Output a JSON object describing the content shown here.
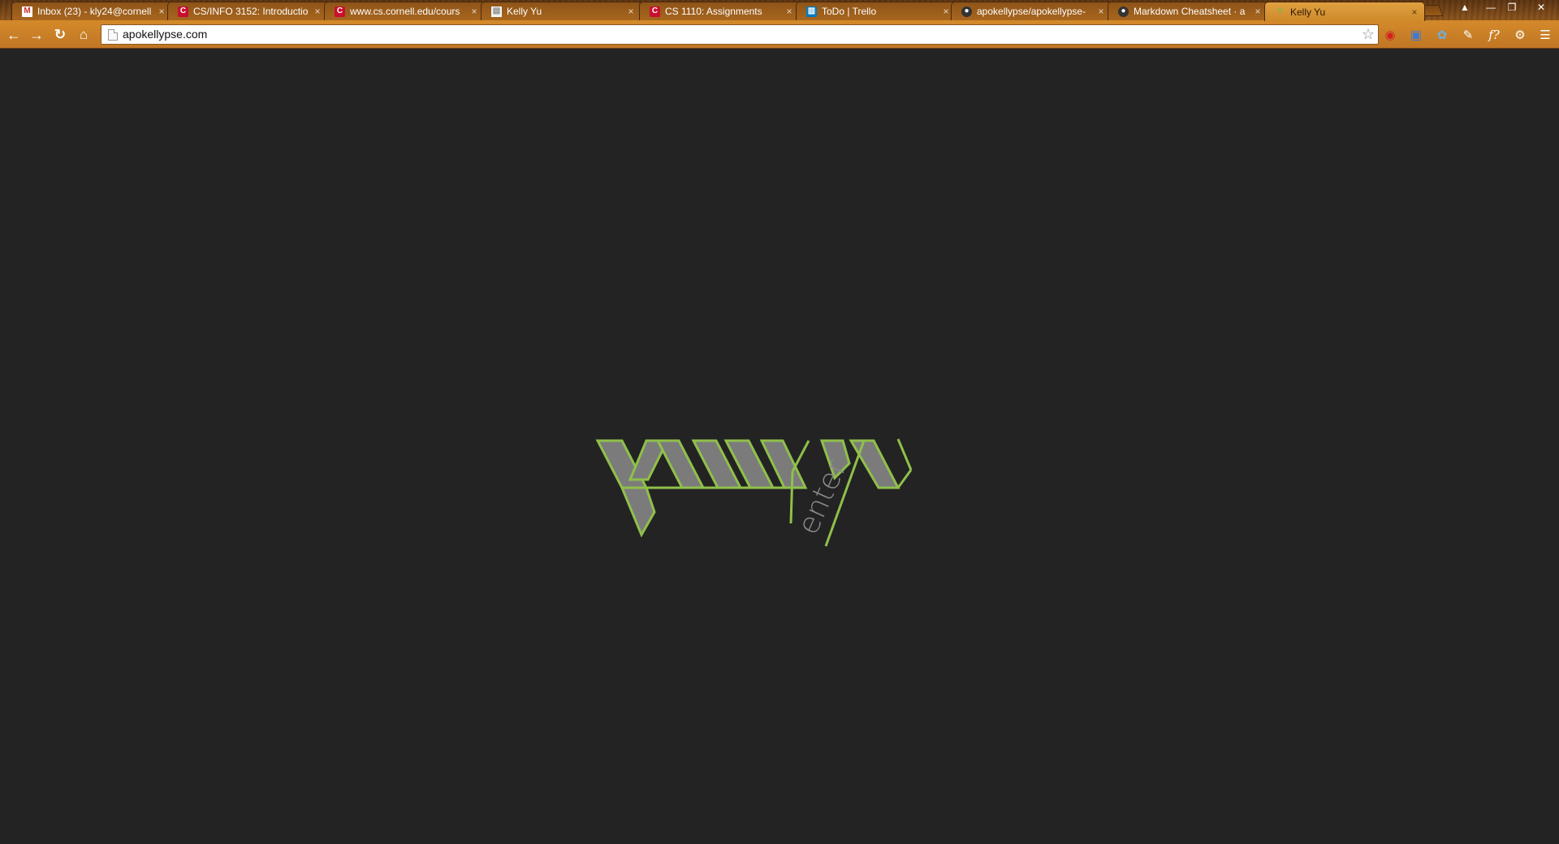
{
  "tabs": [
    {
      "title": "Inbox (23) - kly24@cornell",
      "favicon": "gmail-icon",
      "active": false
    },
    {
      "title": "CS/INFO 3152: Introductio",
      "favicon": "cornell-cs-icon",
      "active": false
    },
    {
      "title": "www.cs.cornell.edu/cours",
      "favicon": "cornell-cs-icon",
      "active": false
    },
    {
      "title": "Kelly Yu",
      "favicon": "document-icon",
      "active": false
    },
    {
      "title": "CS 1110: Assignments",
      "favicon": "cornell-cs-icon",
      "active": false
    },
    {
      "title": "ToDo | Trello",
      "favicon": "trello-icon",
      "active": false
    },
    {
      "title": "apokellypse/apokellypse-",
      "favicon": "github-icon",
      "active": false
    },
    {
      "title": "Markdown Cheatsheet · a",
      "favicon": "github-icon",
      "active": false
    },
    {
      "title": "Kelly Yu",
      "favicon": "kelly-yu-icon",
      "active": true
    }
  ],
  "omnibox": {
    "url": "apokellypse.com"
  },
  "extensions": [
    "adblock-icon",
    "screen-capture-icon",
    "tweetdeck-icon",
    "eyedropper-icon",
    "formula-icon",
    "settings-icon"
  ],
  "logo": {
    "word": "enter",
    "stroke_color": "#8fc04a",
    "fill_color": "#7b7b7b",
    "background": "#232323"
  },
  "colors": {
    "frame": "#b5701f",
    "active_tab": "#e0a040"
  }
}
